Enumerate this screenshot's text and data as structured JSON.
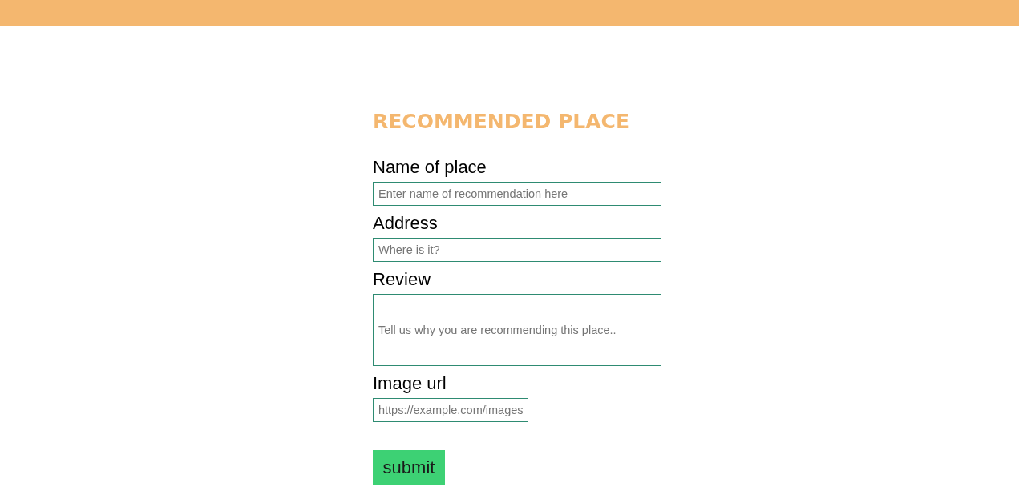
{
  "form": {
    "title": "RECOMMENDED PLACE",
    "fields": [
      {
        "label": "Name of place",
        "placeholder": "Enter name of recommendation here",
        "kind": "text"
      },
      {
        "label": "Address",
        "placeholder": "Where is it?",
        "kind": "text"
      },
      {
        "label": "Review",
        "placeholder": "Tell us why you are recommending this place..",
        "kind": "tall"
      },
      {
        "label": "Image url",
        "placeholder": "https://example.com/images",
        "kind": "short"
      }
    ],
    "submit": {
      "label": "submit"
    }
  }
}
